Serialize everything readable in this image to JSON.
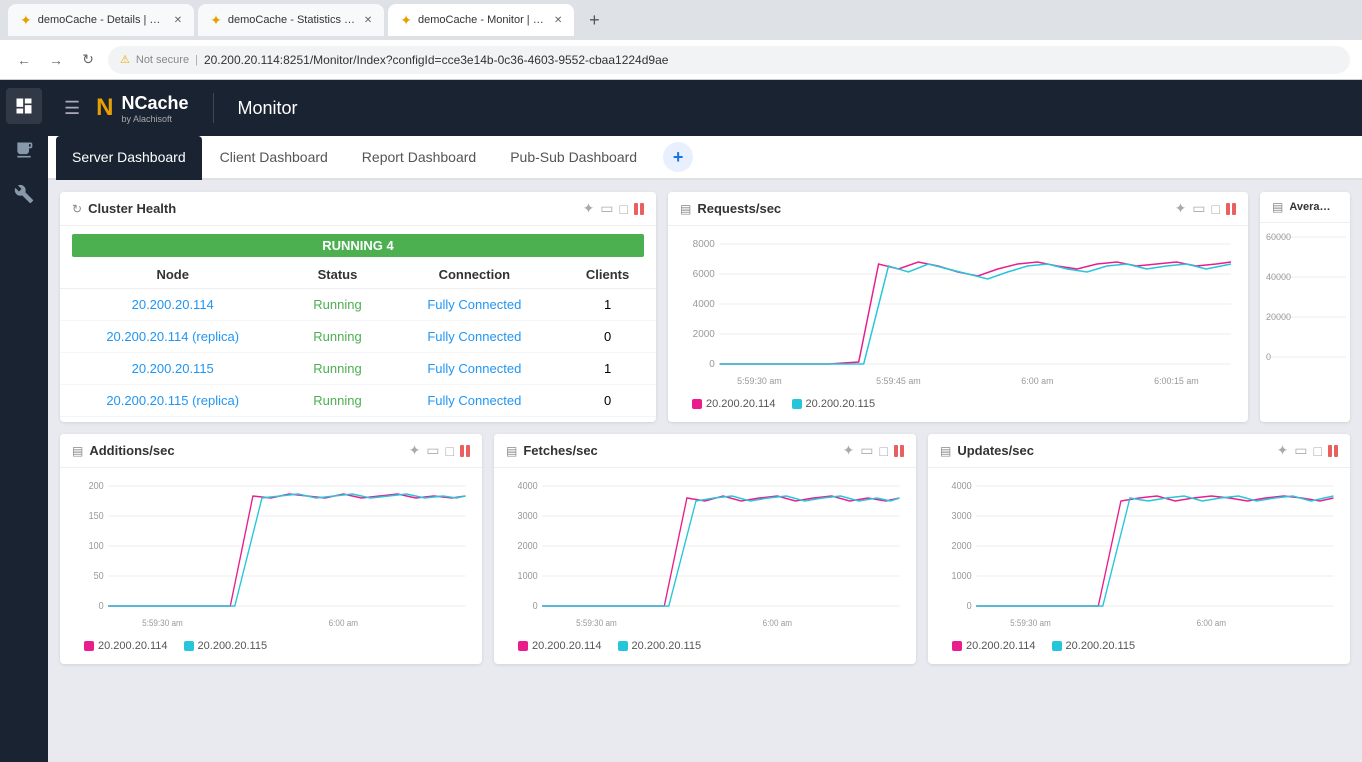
{
  "browser": {
    "tabs": [
      {
        "id": "tab1",
        "label": "demoCache - Details | NCache",
        "active": false
      },
      {
        "id": "tab2",
        "label": "demoCache - Statistics | NCache",
        "active": false
      },
      {
        "id": "tab3",
        "label": "demoCache - Monitor | NCache",
        "active": true
      }
    ],
    "url": "20.200.20.114:8251/Monitor/Index?configId=cce3e14b-0c36-4603-9552-cbaa1224d9ae",
    "security_label": "Not secure"
  },
  "app": {
    "title": "Monitor",
    "logo": "NCache",
    "logo_sub": "by Alachisoft"
  },
  "nav": {
    "tabs": [
      {
        "id": "server",
        "label": "Server Dashboard",
        "active": true
      },
      {
        "id": "client",
        "label": "Client Dashboard",
        "active": false
      },
      {
        "id": "report",
        "label": "Report Dashboard",
        "active": false
      },
      {
        "id": "pubsub",
        "label": "Pub-Sub Dashboard",
        "active": false
      }
    ]
  },
  "cluster_health": {
    "title": "Cluster Health",
    "badge": "RUNNING 4",
    "columns": [
      "Node",
      "Status",
      "Connection",
      "Clients"
    ],
    "rows": [
      {
        "node": "20.200.20.114",
        "status": "Running",
        "connection": "Fully Connected",
        "clients": "1"
      },
      {
        "node": "20.200.20.114 (replica)",
        "status": "Running",
        "connection": "Fully Connected",
        "clients": "0"
      },
      {
        "node": "20.200.20.115",
        "status": "Running",
        "connection": "Fully Connected",
        "clients": "1"
      },
      {
        "node": "20.200.20.115 (replica)",
        "status": "Running",
        "connection": "Fully Connected",
        "clients": "0"
      }
    ]
  },
  "requests_chart": {
    "title": "Requests/sec",
    "y_labels": [
      "8000",
      "6000",
      "4000",
      "2000",
      "0"
    ],
    "x_labels": [
      "5:59:30 am",
      "5:59:45 am",
      "6:00 am",
      "6:00:15 am"
    ],
    "legend": [
      {
        "label": "20.200.20.114",
        "color": "#e91e8c"
      },
      {
        "label": "20.200.20.115",
        "color": "#26c6da"
      }
    ]
  },
  "average_chart": {
    "title": "Average",
    "y_labels": [
      "60000",
      "40000",
      "20000",
      "0"
    ]
  },
  "additions_chart": {
    "title": "Additions/sec",
    "y_labels": [
      "200",
      "150",
      "100",
      "50",
      "0"
    ],
    "x_labels": [
      "5:59:30 am",
      "6:00 am"
    ],
    "legend": [
      {
        "label": "20.200.20.114",
        "color": "#e91e8c"
      },
      {
        "label": "20.200.20.115",
        "color": "#26c6da"
      }
    ]
  },
  "fetches_chart": {
    "title": "Fetches/sec",
    "y_labels": [
      "4000",
      "3000",
      "2000",
      "1000",
      "0"
    ],
    "x_labels": [
      "5:59:30 am",
      "6:00 am"
    ],
    "legend": [
      {
        "label": "20.200.20.114",
        "color": "#e91e8c"
      },
      {
        "label": "20.200.20.115",
        "color": "#26c6da"
      }
    ]
  },
  "updates_chart": {
    "title": "Updates/sec",
    "y_labels": [
      "4000",
      "3000",
      "2000",
      "1000",
      "0"
    ],
    "x_labels": [
      "5:59:30 am",
      "6:00 am"
    ],
    "legend": [
      {
        "label": "20.200.20.114",
        "color": "#e91e8c"
      },
      {
        "label": "20.200.20.115",
        "color": "#26c6da"
      }
    ]
  },
  "colors": {
    "pink": "#e91e8c",
    "teal": "#26c6da",
    "green": "#4caf50",
    "blue": "#2196F3",
    "sidebar_bg": "#1a2332",
    "header_bg": "#1a2332"
  }
}
